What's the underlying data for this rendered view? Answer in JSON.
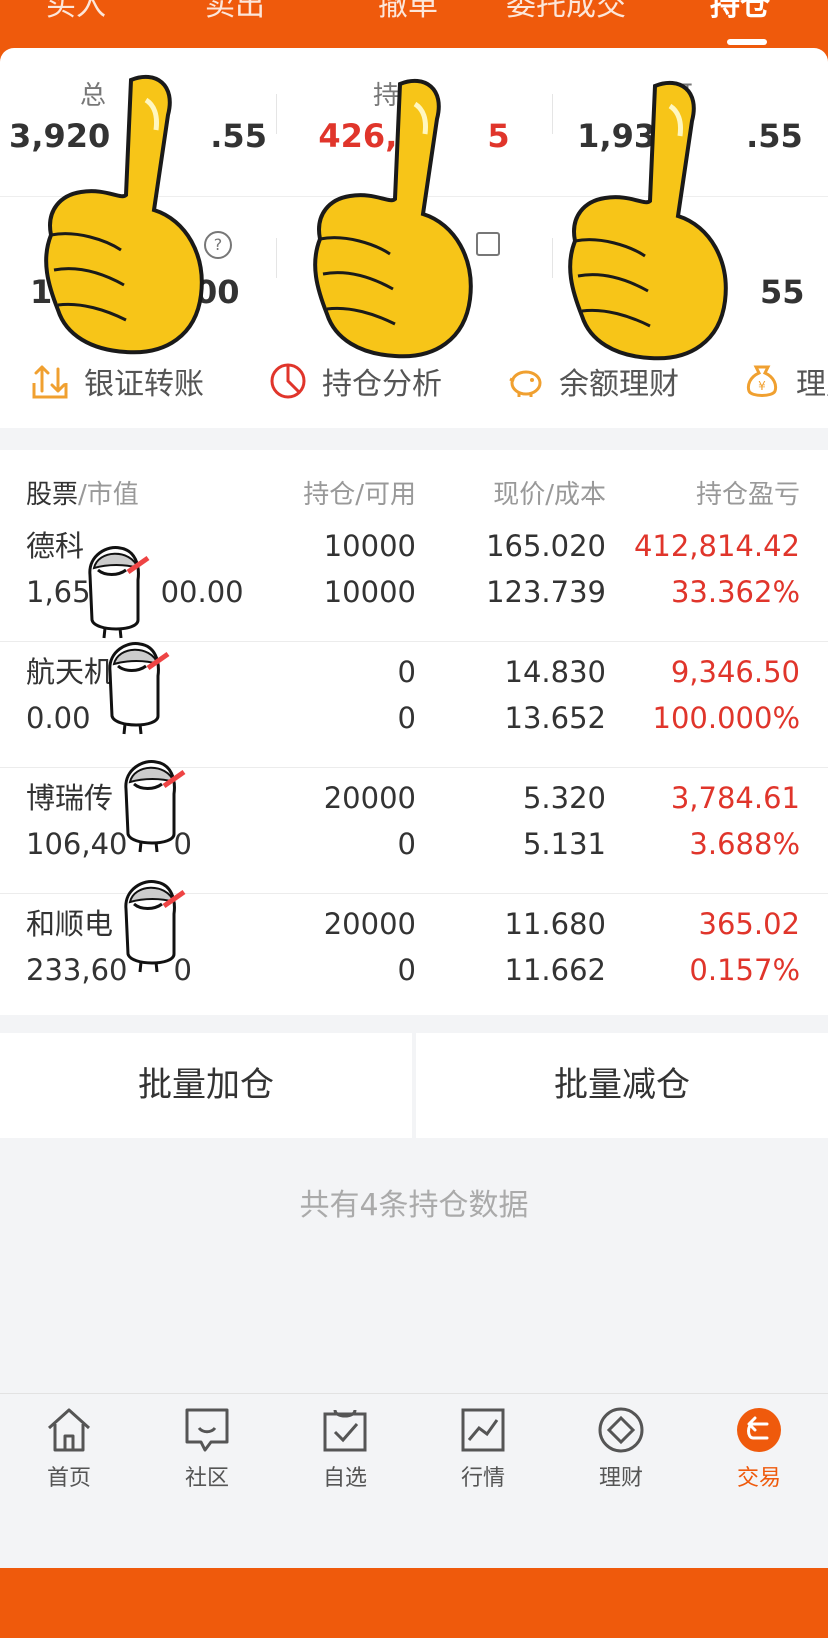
{
  "tabs": [
    "买入",
    "卖出",
    "撤单",
    "委托成交",
    "持仓"
  ],
  "active_tab": "持仓",
  "summary": {
    "row1": [
      {
        "label": "总",
        "value": "3,920",
        "value_tail": ".55"
      },
      {
        "label": "持仓",
        "value": "426,",
        "value_tail": "5"
      },
      {
        "label": "可",
        "value": "1,93",
        "value_tail": ".55"
      }
    ],
    "row2": [
      {
        "value": "1",
        "value_tail": "00"
      },
      {
        "value": "",
        "value_tail": ""
      },
      {
        "value": "",
        "value_tail": "55"
      }
    ]
  },
  "shortcuts": [
    {
      "icon": "transfer-icon",
      "label": "银证转账"
    },
    {
      "icon": "pie-chart-icon",
      "label": "持仓分析"
    },
    {
      "icon": "piggy-bank-icon",
      "label": "余额理财"
    },
    {
      "icon": "money-bag-icon",
      "label": "理财"
    }
  ],
  "table_header": {
    "col1_main": "股票",
    "col1_sub": "/市值",
    "col2": "持仓/可用",
    "col3": "现价/成本",
    "col4": "持仓盈亏"
  },
  "holdings": [
    {
      "name": "德科",
      "market_value_head": "1,65",
      "market_value_tail": "00.00",
      "position": "10000",
      "available": "10000",
      "price": "165.020",
      "cost": "123.739",
      "pnl": "412,814.42",
      "pnl_pct": "33.362%"
    },
    {
      "name": "航天机",
      "market_value_head": "0.00",
      "market_value_tail": "",
      "position": "0",
      "available": "0",
      "price": "14.830",
      "cost": "13.652",
      "pnl": "9,346.50",
      "pnl_pct": "100.000%"
    },
    {
      "name": "博瑞传",
      "market_value_head": "106,40",
      "market_value_tail": "0",
      "position": "20000",
      "available": "0",
      "price": "5.320",
      "cost": "5.131",
      "pnl": "3,784.61",
      "pnl_pct": "3.688%"
    },
    {
      "name": "和顺电",
      "market_value_head": "233,60",
      "market_value_tail": "0",
      "position": "20000",
      "available": "0",
      "price": "11.680",
      "cost": "11.662",
      "pnl": "365.02",
      "pnl_pct": "0.157%"
    }
  ],
  "buttons": {
    "batch_add": "批量加仓",
    "batch_reduce": "批量减仓"
  },
  "footer_note": "共有4条持仓数据",
  "nav": [
    {
      "icon": "home-icon",
      "label": "首页"
    },
    {
      "icon": "community-icon",
      "label": "社区"
    },
    {
      "icon": "watchlist-icon",
      "label": "自选"
    },
    {
      "icon": "market-icon",
      "label": "行情"
    },
    {
      "icon": "finance-icon",
      "label": "理财"
    },
    {
      "icon": "trade-icon",
      "label": "交易"
    }
  ],
  "active_nav": "交易",
  "colors": {
    "brand_orange": "#ef5a0c",
    "profit_red": "#e0352b"
  }
}
